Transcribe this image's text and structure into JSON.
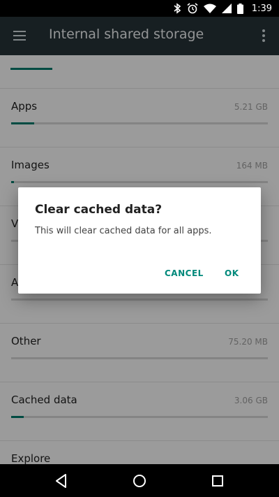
{
  "status_bar": {
    "time": "1:39",
    "icons": [
      "bluetooth-icon",
      "alarm-icon",
      "wifi-icon",
      "signal-icon",
      "battery-icon"
    ]
  },
  "app_bar": {
    "title": "Internal shared storage",
    "menu_icon": "hamburger-menu-icon",
    "overflow_icon": "more-vert-icon"
  },
  "storage": {
    "items": [
      {
        "label": "Apps",
        "size": "5.21 GB",
        "fraction": 0.09
      },
      {
        "label": "Images",
        "size": "164 MB",
        "fraction": 0.01
      },
      {
        "label": "Videos",
        "size": "",
        "fraction": 0.0
      },
      {
        "label": "Audio",
        "size": "",
        "fraction": 0.0
      },
      {
        "label": "Other",
        "size": "75.20 MB",
        "fraction": 0.0
      },
      {
        "label": "Cached data",
        "size": "3.06 GB",
        "fraction": 0.05
      },
      {
        "label": "Explore",
        "size": "",
        "fraction": 0.0
      }
    ]
  },
  "dialog": {
    "title": "Clear cached data?",
    "message": "This will clear cached data for all apps.",
    "cancel_label": "CANCEL",
    "ok_label": "OK"
  },
  "colors": {
    "accent": "#00897b",
    "app_bar": "#263238",
    "progress": "#00796b"
  },
  "nav_bar": {
    "icons": [
      "back-icon",
      "home-icon",
      "recents-icon"
    ]
  }
}
